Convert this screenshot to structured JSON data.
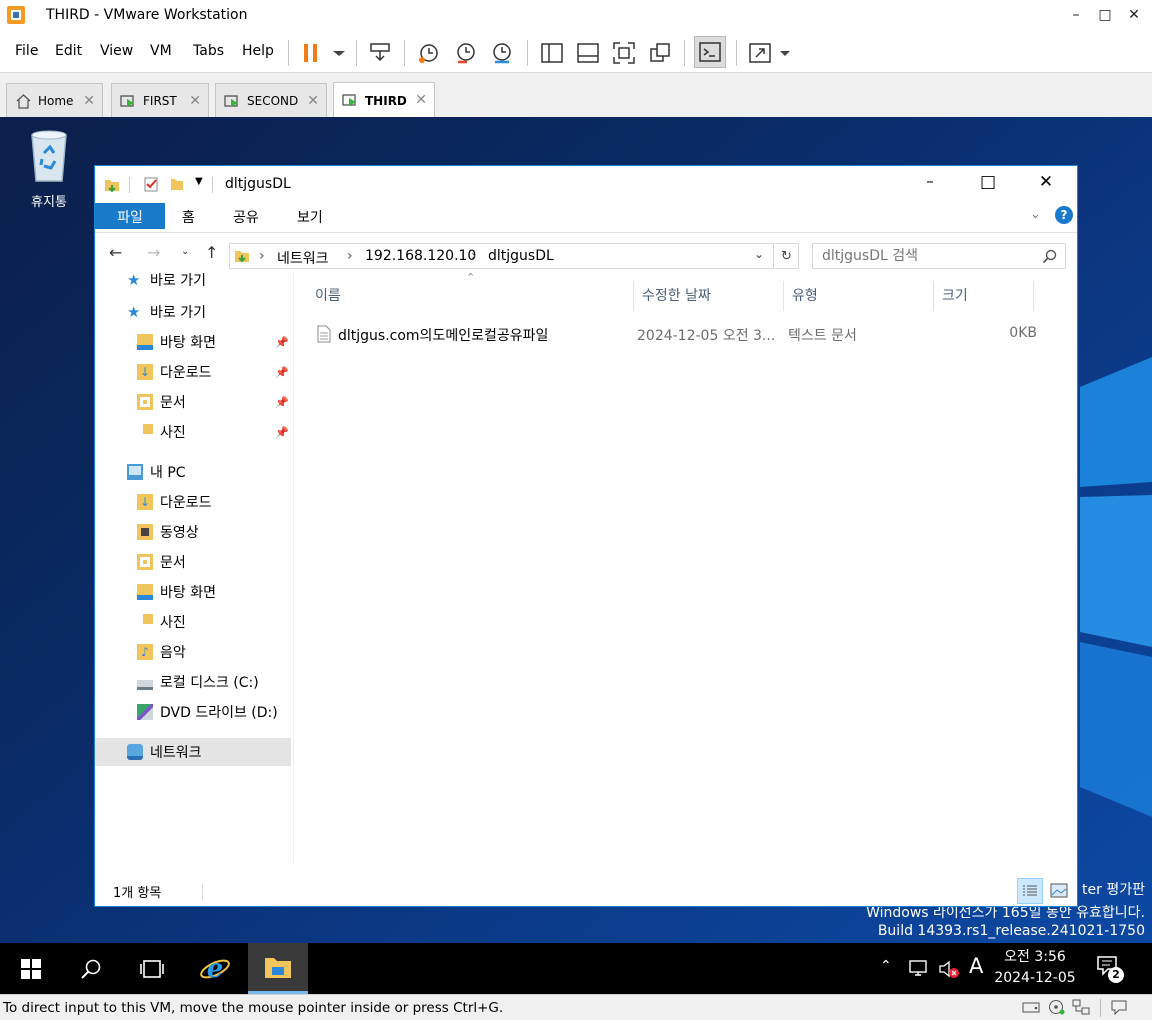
{
  "vmware": {
    "window_title": "THIRD - VMware Workstation",
    "menu": [
      "File",
      "Edit",
      "View",
      "VM",
      "Tabs",
      "Help"
    ],
    "tabs": [
      {
        "label": "Home"
      },
      {
        "label": "FIRST"
      },
      {
        "label": "SECOND"
      },
      {
        "label": "THIRD",
        "active": true
      }
    ],
    "status_message": "To direct input to this VM, move the mouse pointer inside or press Ctrl+G."
  },
  "desktop": {
    "recycle_bin_label": "휴지통",
    "watermark": {
      "line1": "ter 평가판",
      "line2": "Windows 라이선스가 165일 동안 유효합니다.",
      "line3": "Build 14393.rs1_release.241021-1750"
    }
  },
  "explorer": {
    "title": "dltjgusDL",
    "ribbon_tabs": [
      "파일",
      "홈",
      "공유",
      "보기"
    ],
    "breadcrumb": [
      "네트워크",
      "192.168.120.10",
      "dltjgusDL"
    ],
    "search_placeholder": "dltjgusDL 검색",
    "nav": {
      "quick_access": "바로 가기",
      "quick_items": [
        "바탕 화면",
        "다운로드",
        "문서",
        "사진"
      ],
      "this_pc": "내 PC",
      "pc_items": [
        "다운로드",
        "동영상",
        "문서",
        "바탕 화면",
        "사진",
        "음악",
        "로컬 디스크 (C:)",
        "DVD 드라이브 (D:)"
      ],
      "network": "네트워크"
    },
    "columns": [
      "이름",
      "수정한 날짜",
      "유형",
      "크기"
    ],
    "files": [
      {
        "name": "dltjgus.com의도메인로컬공유파일",
        "modified": "2024-12-05 오전 3...",
        "type": "텍스트 문서",
        "size": "0KB"
      }
    ],
    "status": "1개 항목"
  },
  "taskbar": {
    "time": "오전 3:56",
    "date": "2024-12-05",
    "ime": "A",
    "notification_count": "2"
  },
  "colors": {
    "accent": "#1979ca",
    "desktop": "#0b3a88",
    "taskbar": "#000000"
  }
}
